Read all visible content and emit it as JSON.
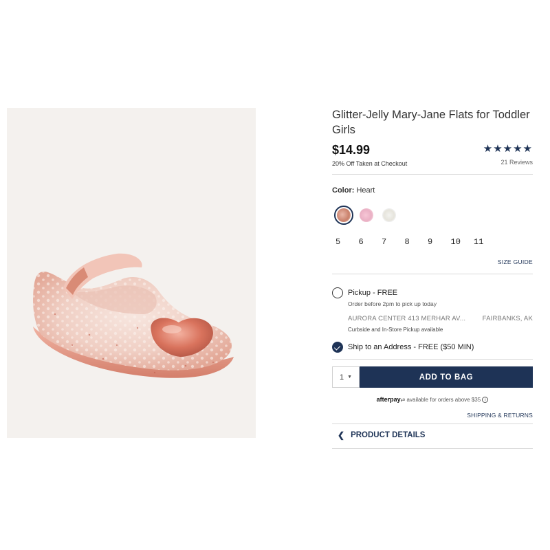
{
  "product": {
    "title": "Glitter-Jelly Mary-Jane Flats for Toddler Girls",
    "price": "$14.99",
    "promo": "20% Off Taken at Checkout",
    "rating_stars": "★★★★★",
    "rating_value": 5,
    "reviews": "21 Reviews"
  },
  "color": {
    "label": "Color:",
    "selected": "Heart",
    "swatches": [
      "heart-swatch",
      "pink-swatch",
      "white-swatch"
    ]
  },
  "sizes": [
    "5",
    "6",
    "7",
    "8",
    "9",
    "10",
    "11"
  ],
  "size_guide": "SIZE GUIDE",
  "fulfillment": {
    "pickup_label": "Pickup - FREE",
    "pickup_hint": "Order before 2pm to pick up today",
    "store_name": "AURORA CENTER 413 MERHAR AV...",
    "store_city": "FAIRBANKS, AK",
    "curbside": "Curbside and In-Store Pickup available",
    "ship_label": "Ship to an Address - FREE ($50 MIN)"
  },
  "cart": {
    "quantity": "1",
    "add_label": "ADD TO BAG"
  },
  "afterpay": {
    "brand": "afterpay",
    "text": "available for orders above $35"
  },
  "shipping_returns": "SHIPPING & RETURNS",
  "product_details": "PRODUCT DETAILS",
  "colors": {
    "navy": "#1e3356",
    "image_bg": "#f4f1ee"
  }
}
